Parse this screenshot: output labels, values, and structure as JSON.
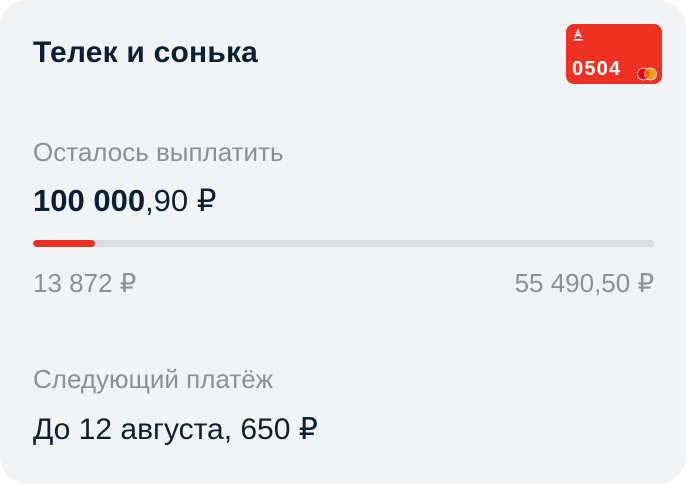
{
  "card": {
    "title": "Телек и сонька",
    "bank_card": {
      "number": "0504",
      "logo_icon": "alfa-bank-logo-icon",
      "payment_system_icon": "mastercard-icon",
      "color": "#ef3124"
    }
  },
  "remaining": {
    "label": "Осталось выплатить",
    "amount_integer": "100 000",
    "amount_fraction": ",90 ₽"
  },
  "progress": {
    "paid": "13 872 ₽",
    "total": "55 490,50 ₽",
    "fraction": 0.1,
    "accent_color": "#ef3124",
    "track_color": "#dbdcde"
  },
  "next_payment": {
    "label": "Следующий платёж",
    "value": "До 12 августа, 650 ₽"
  }
}
